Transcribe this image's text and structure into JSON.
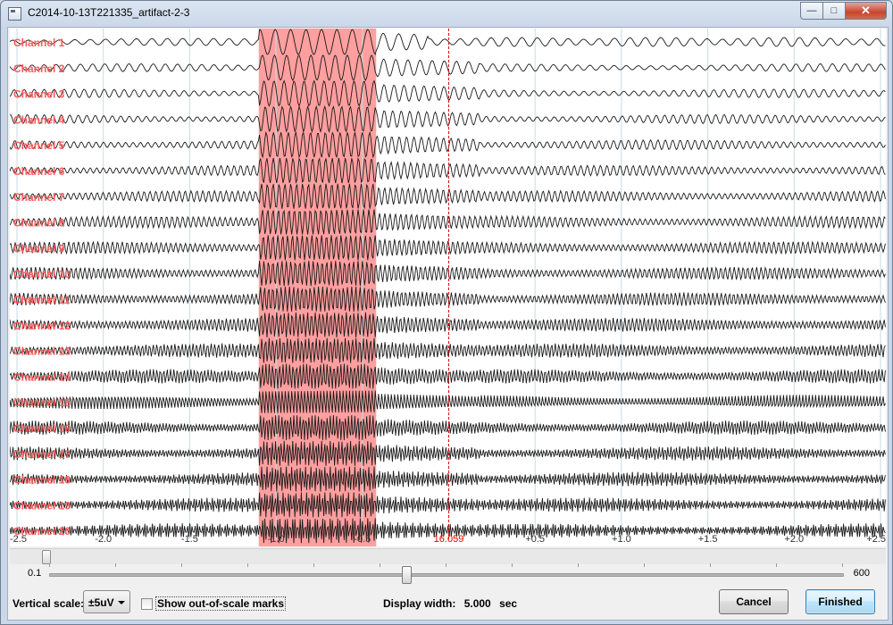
{
  "window": {
    "title": "C2014-10-13T221335_artifact-2-3",
    "minimize_icon": "minimize-icon",
    "maximize_icon": "maximize-icon",
    "close_icon": "close-icon",
    "minimize_glyph": "—",
    "maximize_glyph": "□",
    "close_glyph": "✕"
  },
  "plot": {
    "channels": [
      "Channel 1",
      "Channel 2",
      "Channel 3",
      "Channel 4",
      "Channel 5",
      "Channel 6",
      "Channel 7",
      "Channel 8",
      "Channel 9",
      "Channel 10",
      "Channel 11",
      "Channel 12",
      "Channel 13",
      "Channel 14",
      "Channel 15",
      "Channel 16",
      "Channel 17",
      "Channel 18",
      "Channel 19",
      "Channel 20"
    ],
    "x_ticks": [
      "-2.5",
      "-2.0",
      "-1.5",
      "-1.0",
      "-0.5",
      "16.059",
      "+0.5",
      "+1.0",
      "+1.5",
      "+2.0",
      "+2.5"
    ],
    "x_tick_values": [
      -2.5,
      -2.0,
      -1.5,
      -1.0,
      -0.5,
      0,
      0.5,
      1.0,
      1.5,
      2.0,
      2.5
    ],
    "cursor_label": "16.059",
    "artifact_region": {
      "start": -1.1,
      "end": -0.42
    },
    "colors": {
      "channel_label": "#ff5c5c",
      "artifact": "#ff9f9f",
      "cursor": "#e00000",
      "grid": "#c9dbe6",
      "trace": "#1a1a1a"
    }
  },
  "horizontal_scrollbar": {
    "position": 0.0
  },
  "slider": {
    "min_label": "0.1",
    "max_label": "600",
    "position": 0.46
  },
  "controls": {
    "vertical_scale_label": "Vertical scale:",
    "vertical_scale_value": "±5uV",
    "dropdown_arrow_icon": "chevron-down-icon",
    "show_out_of_scale_label": "Show out-of-scale marks",
    "show_out_of_scale_checked": false,
    "display_width_label": "Display width:",
    "display_width_value": "5.000",
    "display_width_unit": "sec"
  },
  "buttons": {
    "cancel": "Cancel",
    "finished": "Finished"
  }
}
